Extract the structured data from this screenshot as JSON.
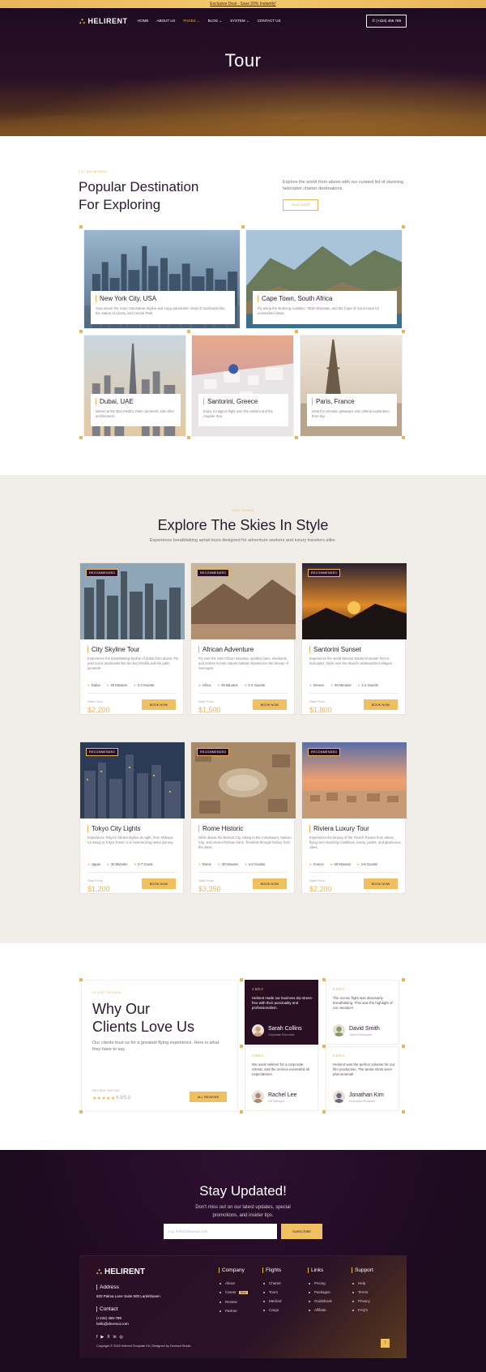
{
  "topbar": {
    "text": "Exclusive Deal - Save 20% Instantly!"
  },
  "nav": {
    "logo": "HELIRENT",
    "items": [
      {
        "label": "HOME"
      },
      {
        "label": "ABOUT US"
      },
      {
        "label": "PAGES ⌄"
      },
      {
        "label": "BLOG ⌄"
      },
      {
        "label": "SYSTEM ⌄"
      },
      {
        "label": "CONTACT US"
      }
    ],
    "active_index": 2,
    "phone": "✆ (+234) 456 789"
  },
  "hero": {
    "title": "Tour"
  },
  "destinations": {
    "eyebrow": "FLY ANYWHERE",
    "title_line1": "Popular Destination",
    "title_line2": "For Exploring",
    "description": "Explore the world from above with our curated list of stunning helicopter charter destinations.",
    "button": "VIEW MORE",
    "cards": [
      {
        "title": "New York City, USA",
        "text": "Soar above the iconic Manhattan skyline and enjoy panoramic views of landmarks like the Statue of Liberty and Central Park."
      },
      {
        "title": "Cape Town, South Africa",
        "text": "Fly along the stunning coastline, Table Mountain, and the Cape of Good Hope for unmatched vistas."
      },
      {
        "title": "Dubai, UAE",
        "text": "Marvel at the Burj Khalifa, Palm Jumeirah, and other architectural"
      },
      {
        "title": "Santorini, Greece",
        "text": "Enjoy a magical flight over the caldera and the Aegean Sea."
      },
      {
        "title": "Paris, France",
        "text": "Ideal for romantic getaways and cultural exploration from sky."
      }
    ]
  },
  "tours": {
    "eyebrow": "OUR TOURS",
    "title": "Explore The Skies In Style",
    "subtitle": "Experience breathtaking aerial tours designed for adventure seekers and luxury travelers alike.",
    "badge": "RECOMMENDED",
    "from_label": "Start From",
    "book_label": "BOOK NOW",
    "cards": [
      {
        "title": "City Skyline Tour",
        "desc": "Experience the breathtaking skyline of dubai from above. Fly past iconic landmarks like the burj khalifa and the palm jumeirah.",
        "place": "Dubai",
        "duration": "45 Minutes",
        "guests": "2-4 Guests",
        "price": "$2,200"
      },
      {
        "title": "African Adventure",
        "desc": "Fly over the vast African savanna, spotting lions, elephants, and zebras in their natural habitat. Experience the beauty of Serengeti.",
        "place": "Africa",
        "duration": "35 Minutes",
        "guests": "2-4 Guests",
        "price": "$1,500"
      },
      {
        "title": "Santorini Sunset",
        "desc": "Experience the world-famous Santorini sunset from a helicopter. Glide over the island's whitewashed villages.",
        "place": "Greece",
        "duration": "50 Minutes",
        "guests": "1-2 Guests",
        "price": "$1,800"
      },
      {
        "title": "Tokyo City Lights",
        "desc": "Experience Tokyo's vibrant skyline at night, from Shibuya Crossing to Tokyo Tower, in a mesmerizing aerial journey.",
        "place": "Japan",
        "duration": "30 Minutes",
        "guests": "2-7 Guest",
        "price": "$1,200"
      },
      {
        "title": "Rome Historic",
        "desc": "Glide above the Eternal City, taking in the Colosseum, Vatican City, and ancient Roman ruins. Timeless through history from the skies.",
        "place": "Rome",
        "duration": "30 Minutes",
        "guests": "2-8 Guests",
        "price": "$3,350"
      },
      {
        "title": "Riviera Luxury Tour",
        "desc": "Experience the beauty of the French Riviera from above, flying over stunning coastlines, luxury yachts, and glamorous cities.",
        "place": "France",
        "duration": "50 Minutes",
        "guests": "2-6 Guests",
        "price": "$2,200"
      }
    ]
  },
  "reviews": {
    "eyebrow": "CLIENT REVIEW",
    "title_line1": "Why Our",
    "title_line2": "Clients Love Us",
    "desc": "Our clients trust us for a greatest flying experience. Here is what they have to say.",
    "rating_label": "REVIEW RATING",
    "stars": "★★★★★",
    "rating": "4.9/5.0",
    "button": "ALL REVIEWS",
    "cards": [
      {
        "score": "4.8/5.0",
        "text": "Helirent made our business trip stress-free with their punctuality and professionalism.",
        "name": "Sarah Collins",
        "role": "Corporate Executive"
      },
      {
        "score": "5.0/5.0",
        "text": "The scenic flight was absolutely breathtaking. This was the highlight of our vacation!",
        "name": "David Smith",
        "role": "Travel Enthusiast"
      },
      {
        "score": "4.8/5.0",
        "text": "We used Helirent for a corporate retreat, and the service exceeded all expectations.",
        "name": "Rachel Lee",
        "role": "HR Manager"
      },
      {
        "score": "5.0/5.0",
        "text": "Helirent was the perfect solution for our film production. The aerial shots were phenomenal!",
        "name": "Jonathan Kim",
        "role": "Filmmaker/Producer"
      }
    ]
  },
  "subscribe": {
    "title": "Stay Updated!",
    "desc_line1": "Don't miss out on our latest updates, special",
    "desc_line2": "promotions, and insider tips.",
    "placeholder": "e.g. hello@devesut.com",
    "button": "SUBSCRIBE"
  },
  "footer": {
    "logo": "HELIRENT",
    "address_head": "Address",
    "address": "920 Palma Lane Suite 500 Larkinhaven",
    "contact_head": "Contact",
    "phone": "(+234) 456-789",
    "email": "hello@devesut.com",
    "columns": [
      {
        "head": "Company",
        "items": [
          "About",
          "Career",
          "Review",
          "Partner"
        ],
        "badge": "New"
      },
      {
        "head": "Flights",
        "items": [
          "Charter",
          "Tours",
          "Medical",
          "Cargo"
        ]
      },
      {
        "head": "Links",
        "items": [
          "Pricing",
          "Packages",
          "Guidebook",
          "Affiliate"
        ]
      },
      {
        "head": "Support",
        "items": [
          "Help",
          "Terms",
          "Privacy",
          "FAQ's"
        ]
      }
    ],
    "social": [
      "f",
      "▶",
      "X",
      "in",
      "◎"
    ],
    "copyright": "Copyright © 2025 Helirent Template Kit | Designed by Devesut Studio",
    "up": "↑"
  },
  "colors": {
    "accent": "#e8b55a",
    "dark": "#2a0f22"
  }
}
